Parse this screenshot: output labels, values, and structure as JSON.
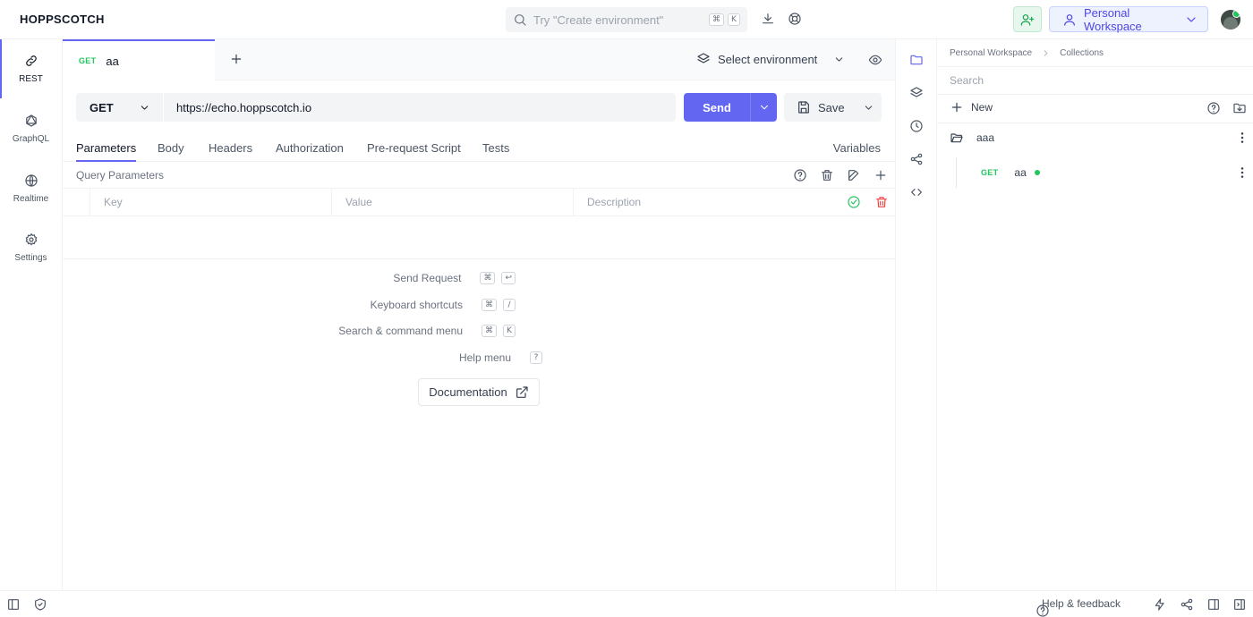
{
  "app": {
    "brand": "HOPPSCOTCH",
    "search_placeholder": "Try \"Create environment\"",
    "search_keys": [
      "⌘",
      "K"
    ],
    "workspace": "Personal Workspace"
  },
  "nav": [
    {
      "label": "REST",
      "icon": "link-icon",
      "active": true
    },
    {
      "label": "GraphQL",
      "icon": "graphql-icon"
    },
    {
      "label": "Realtime",
      "icon": "globe-icon"
    },
    {
      "label": "Settings",
      "icon": "gear-icon"
    }
  ],
  "tab": {
    "method": "GET",
    "name": "aa"
  },
  "environment": {
    "label": "Select environment"
  },
  "request": {
    "method": "GET",
    "url": "https://echo.hoppscotch.io",
    "send_label": "Send",
    "save_label": "Save"
  },
  "request_tabs": [
    "Parameters",
    "Body",
    "Headers",
    "Authorization",
    "Pre-request Script",
    "Tests"
  ],
  "variables_label": "Variables",
  "params": {
    "title": "Query Parameters",
    "key_placeholder": "Key",
    "value_placeholder": "Value",
    "description_placeholder": "Description"
  },
  "shortcuts": [
    {
      "label": "Send Request",
      "keys": [
        "⌘",
        "↩"
      ]
    },
    {
      "label": "Keyboard shortcuts",
      "keys": [
        "⌘",
        "/"
      ]
    },
    {
      "label": "Search & command menu",
      "keys": [
        "⌘",
        "K"
      ]
    },
    {
      "label": "Help menu",
      "keys": [
        "?"
      ]
    }
  ],
  "documentation_label": "Documentation",
  "collections": {
    "breadcrumb": [
      "Personal Workspace",
      "Collections"
    ],
    "search_placeholder": "Search",
    "new_label": "New",
    "folder": "aaa",
    "request": {
      "method": "GET",
      "name": "aa"
    }
  },
  "footer": {
    "help_label": "Help & feedback"
  },
  "colors": {
    "accent": "#6366f1",
    "get": "#22c55e",
    "danger": "#ef4444"
  }
}
